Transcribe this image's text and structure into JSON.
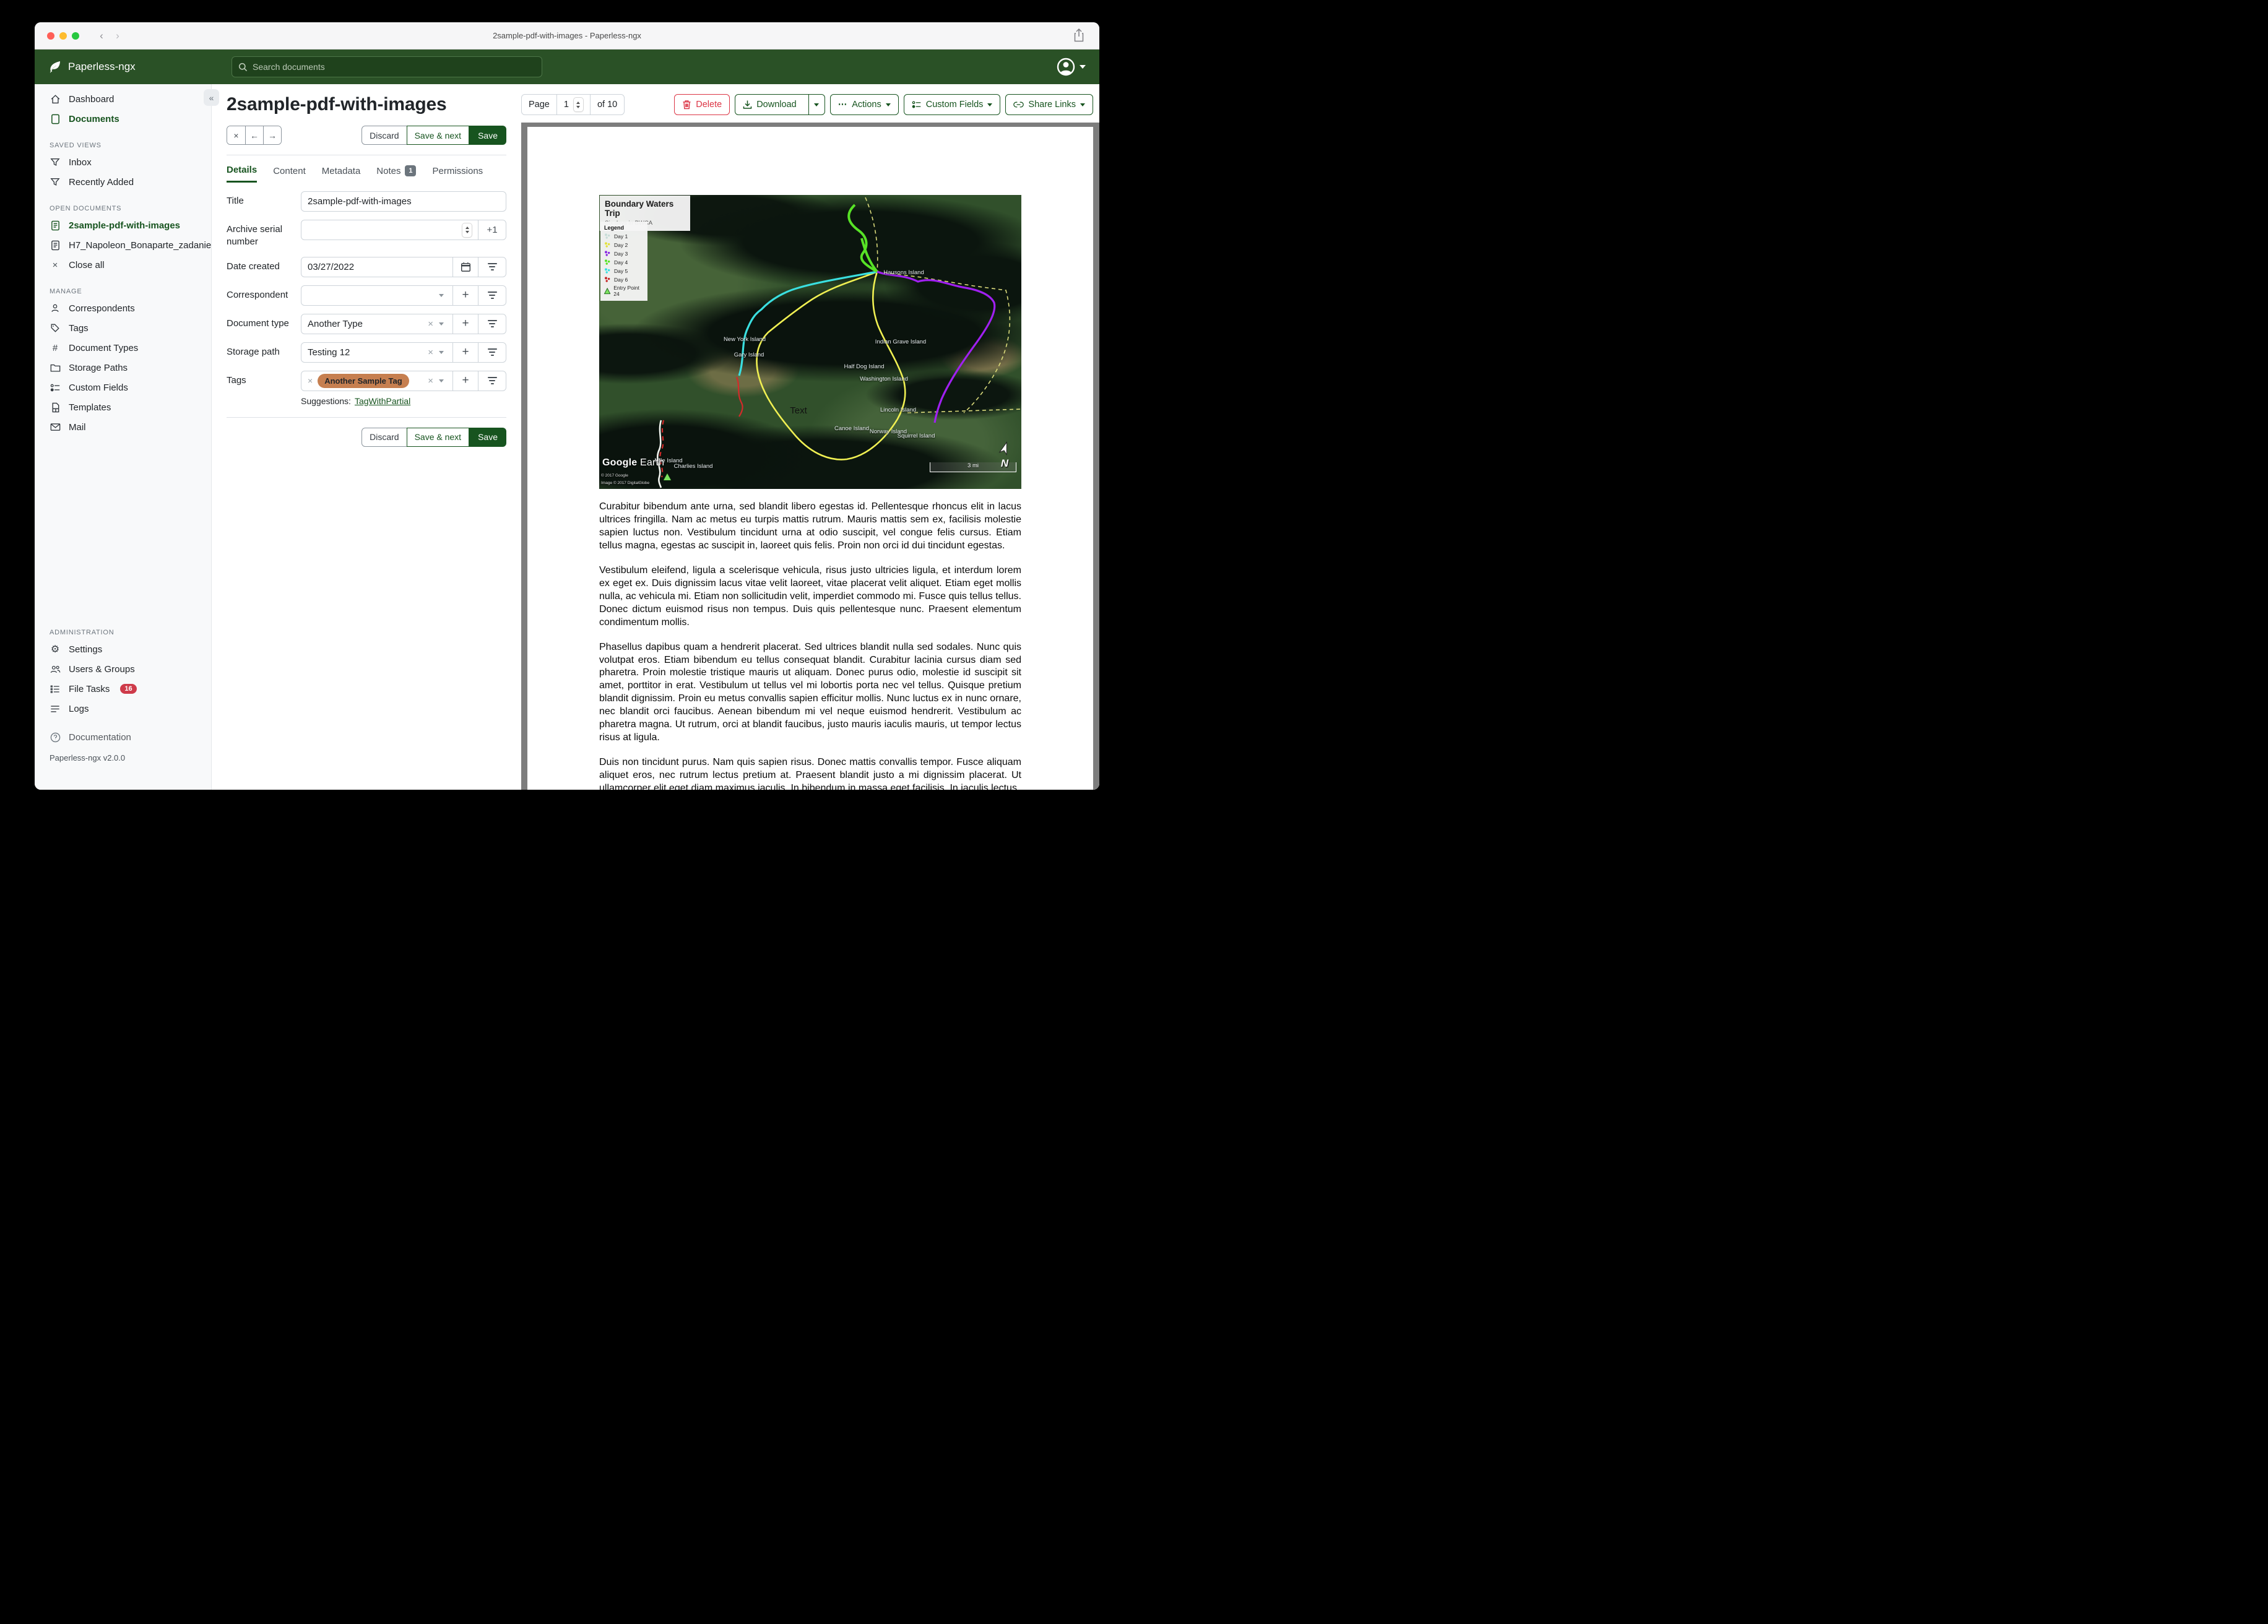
{
  "window": {
    "title": "2sample-pdf-with-images - Paperless-ngx"
  },
  "header": {
    "app_name": "Paperless-ngx",
    "search_placeholder": "Search documents"
  },
  "sidebar": {
    "primary": [
      {
        "label": "Dashboard"
      },
      {
        "label": "Documents"
      }
    ],
    "sections": [
      {
        "title": "SAVED VIEWS",
        "items": [
          {
            "label": "Inbox"
          },
          {
            "label": "Recently Added"
          }
        ]
      },
      {
        "title": "OPEN DOCUMENTS",
        "items": [
          {
            "label": "2sample-pdf-with-images"
          },
          {
            "label": "H7_Napoleon_Bonaparte_zadanie"
          },
          {
            "label": "Close all"
          }
        ]
      },
      {
        "title": "MANAGE",
        "items": [
          {
            "label": "Correspondents"
          },
          {
            "label": "Tags"
          },
          {
            "label": "Document Types"
          },
          {
            "label": "Storage Paths"
          },
          {
            "label": "Custom Fields"
          },
          {
            "label": "Templates"
          },
          {
            "label": "Mail"
          }
        ]
      },
      {
        "title": "ADMINISTRATION",
        "items": [
          {
            "label": "Settings"
          },
          {
            "label": "Users & Groups"
          },
          {
            "label": "File Tasks",
            "badge": "16"
          },
          {
            "label": "Logs"
          }
        ]
      }
    ],
    "footer": {
      "documentation": "Documentation",
      "version": "Paperless-ngx v2.0.0"
    }
  },
  "toolbar": {
    "page_label": "Page",
    "page_value": "1",
    "page_total": "of 10",
    "delete_label": "Delete",
    "download_label": "Download",
    "actions_label": "Actions",
    "custom_fields_label": "Custom Fields",
    "share_links_label": "Share Links"
  },
  "document": {
    "title": "2sample-pdf-with-images",
    "actions": {
      "discard": "Discard",
      "save_next": "Save & next",
      "save": "Save"
    },
    "tabs": [
      {
        "label": "Details"
      },
      {
        "label": "Content"
      },
      {
        "label": "Metadata"
      },
      {
        "label": "Notes",
        "badge": "1"
      },
      {
        "label": "Permissions"
      }
    ],
    "fields": {
      "title": {
        "label": "Title",
        "value": "2sample-pdf-with-images"
      },
      "asn": {
        "label": "Archive serial number",
        "value": "",
        "increment": "+1"
      },
      "date_created": {
        "label": "Date created",
        "value": "03/27/2022"
      },
      "correspondent": {
        "label": "Correspondent",
        "value": ""
      },
      "document_type": {
        "label": "Document type",
        "value": "Another Type"
      },
      "storage_path": {
        "label": "Storage path",
        "value": "Testing 12"
      },
      "tags": {
        "label": "Tags",
        "value": "Another Sample Tag",
        "tag_color": "#c67f50"
      },
      "suggestions_label": "Suggestions:",
      "suggestion_link": "TagWithPartial"
    }
  },
  "preview": {
    "map": {
      "title": "Boundary Waters Trip",
      "subtitle": "Six days in BWCA",
      "legend_title": "Legend",
      "legend": [
        {
          "label": "Day 1",
          "color": "#c7ddd8"
        },
        {
          "label": "Day 2",
          "color": "#e2e23c"
        },
        {
          "label": "Day 3",
          "color": "#8a2be2"
        },
        {
          "label": "Day 4",
          "color": "#57e226"
        },
        {
          "label": "Day 5",
          "color": "#3adfe0"
        },
        {
          "label": "Day 6",
          "color": "#c62828"
        },
        {
          "label": "Entry Point 24",
          "color": "#7be25e",
          "shape": "triangle"
        }
      ],
      "labels": [
        "New York Island",
        "Gary Island",
        "Hausons Island",
        "Indian Grave Island",
        "Half Dog Island",
        "Washington Island",
        "Lincoln Island",
        "Canoe Island",
        "Norway Island",
        "Squirrel Island",
        "Text",
        "Mile Island",
        "Charlies Island"
      ],
      "routes": [
        {
          "name": "boundary",
          "color": "#d9d97a"
        },
        {
          "name": "Day 2",
          "color": "#f0f052"
        },
        {
          "name": "Day 5",
          "color": "#3adfe0"
        },
        {
          "name": "Day 4",
          "color": "#57e226"
        },
        {
          "name": "Day 3",
          "color": "#a020f0"
        },
        {
          "name": "Day 1",
          "color": "#f2f5f0"
        },
        {
          "name": "Day 6",
          "color": "#d42a2a"
        }
      ],
      "credits": {
        "logo": "Google Earth",
        "line1": "© 2017 Google",
        "line2": "Image © 2017 DigitalGlobe"
      },
      "scale_label": "3 mi",
      "north_label": "N"
    },
    "paragraphs": [
      "Curabitur bibendum ante urna, sed blandit libero egestas id. Pellentesque rhoncus elit in lacus ultrices fringilla. Nam ac metus eu turpis mattis rutrum. Mauris mattis sem ex, facilisis molestie sapien luctus non. Vestibulum tincidunt urna at odio suscipit, vel congue felis cursus. Etiam tellus magna, egestas ac suscipit in, laoreet quis felis. Proin non orci id dui tincidunt egestas.",
      "Vestibulum eleifend, ligula a scelerisque vehicula, risus justo ultricies ligula, et interdum lorem ex eget ex. Duis dignissim lacus vitae velit laoreet, vitae placerat velit aliquet. Etiam eget mollis nulla, ac vehicula mi. Etiam non sollicitudin velit, imperdiet commodo mi. Fusce quis tellus tellus. Donec dictum euismod risus non tempus. Duis quis pellentesque nunc. Praesent elementum condimentum mollis.",
      "Phasellus dapibus quam a hendrerit placerat. Sed ultrices blandit nulla sed sodales. Nunc quis volutpat eros. Etiam bibendum eu tellus consequat blandit. Curabitur lacinia cursus diam sed pharetra. Proin molestie tristique mauris ut aliquam. Donec purus odio, molestie id suscipit sit amet, porttitor in erat. Vestibulum ut tellus vel mi lobortis porta nec vel tellus. Quisque pretium blandit dignissim. Proin eu metus convallis sapien efficitur mollis. Nunc luctus ex in nunc ornare, nec blandit orci faucibus. Aenean bibendum mi vel neque euismod hendrerit. Vestibulum ac pharetra magna. Ut rutrum, orci at blandit faucibus, justo mauris iaculis mauris, ut tempor lectus risus at ligula.",
      "Duis non tincidunt purus. Nam quis sapien risus. Donec mattis convallis tempor. Fusce aliquam aliquet eros, nec rutrum lectus pretium at. Praesent blandit justo a mi dignissim placerat. Ut ullamcorper elit eget diam maximus iaculis. In bibendum in massa eget facilisis. In iaculis lectus"
    ]
  }
}
